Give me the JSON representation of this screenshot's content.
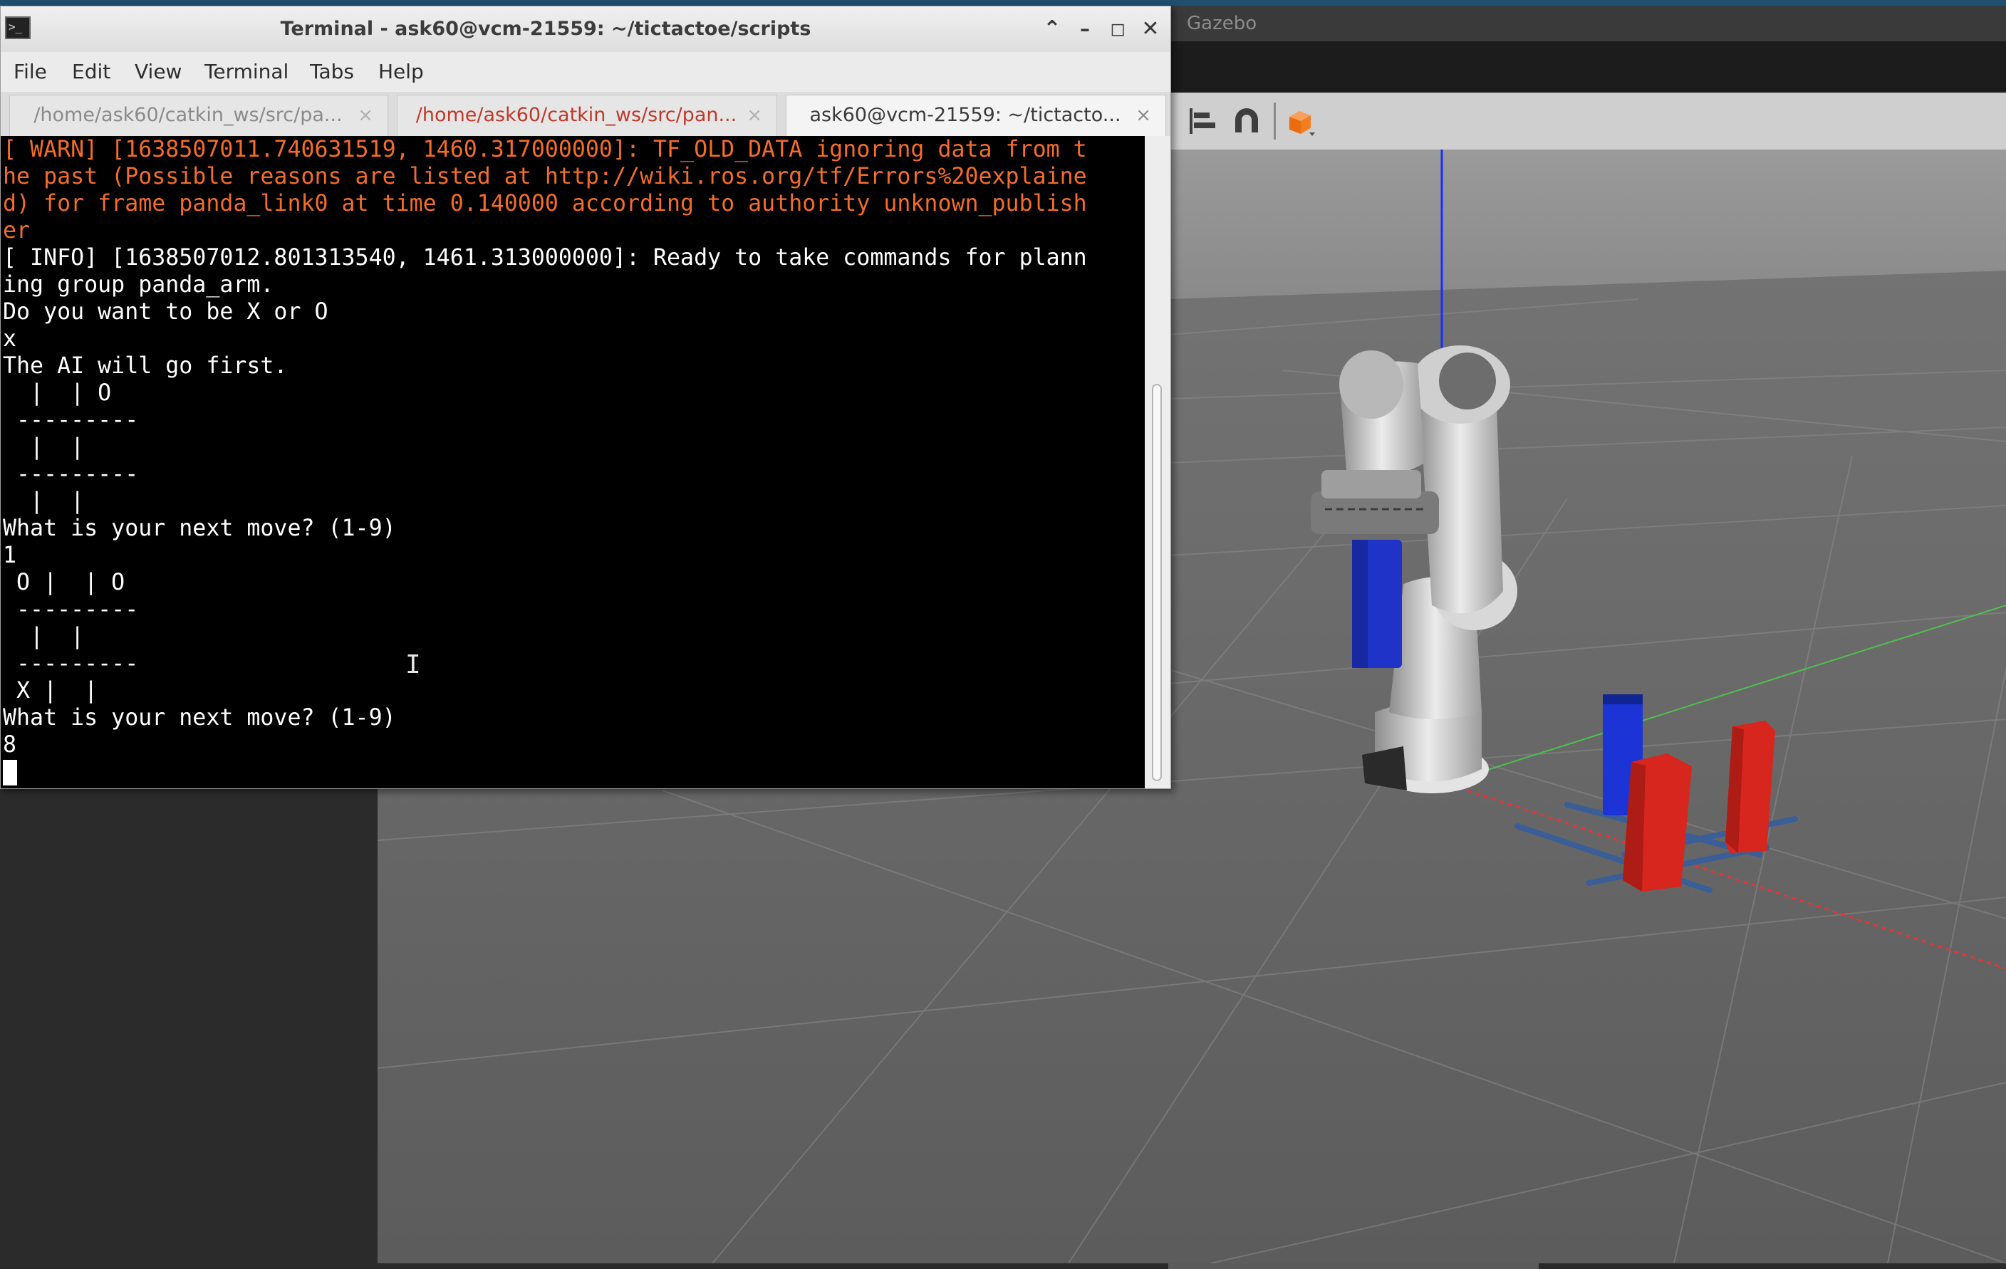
{
  "gazebo": {
    "title": "Gazebo",
    "toolbar_icons": [
      "align-icon",
      "magnet-snap-icon",
      "box-shape-icon"
    ]
  },
  "terminal": {
    "title": "Terminal - ask60@vcm-21559: ~/tictactoe/scripts",
    "menu": [
      "File",
      "Edit",
      "View",
      "Terminal",
      "Tabs",
      "Help"
    ],
    "tabs": [
      {
        "label": "/home/ask60/catkin_ws/src/pa...",
        "close": "×"
      },
      {
        "label": "/home/ask60/catkin_ws/src/pan...",
        "close": "×"
      },
      {
        "label": "ask60@vcm-21559: ~/tictacto...",
        "close": "×"
      }
    ],
    "warn_lines": [
      "[ WARN] [1638507011.740631519, 1460.317000000]: TF_OLD_DATA ignoring data from t",
      "he past (Possible reasons are listed at http://wiki.ros.org/tf/Errors%20explaine",
      "d) for frame panda_link0 at time 0.140000 according to authority unknown_publish",
      "er"
    ],
    "output_lines": [
      "[ INFO] [1638507012.801313540, 1461.313000000]: Ready to take commands for plann",
      "ing group panda_arm.",
      "Do you want to be X or O",
      "x",
      "The AI will go first.",
      "  |  | O",
      " ---------",
      "  |  |",
      " ---------",
      "  |  |",
      "What is your next move? (1-9)",
      "1",
      " O |  | O",
      " ---------",
      "  |  |",
      " ---------",
      " X |  |",
      "What is your next move? (1-9)",
      "8"
    ]
  }
}
